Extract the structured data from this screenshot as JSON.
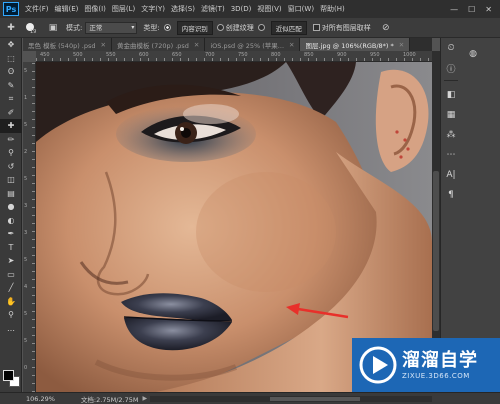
{
  "app": {
    "logo": "Ps"
  },
  "menubar": {
    "items": [
      "文件(F)",
      "编辑(E)",
      "图像(I)",
      "图层(L)",
      "文字(Y)",
      "选择(S)",
      "滤镜(T)",
      "3D(D)",
      "视图(V)",
      "窗口(W)",
      "帮助(H)"
    ],
    "window_controls": [
      "—",
      "☐",
      "✕"
    ]
  },
  "options": {
    "brush_size": "19",
    "mode_label": "模式:",
    "mode_value": "正常",
    "type_label": "类型:",
    "type_options": [
      {
        "label": "内容识别",
        "selected": true
      },
      {
        "label": "创建纹理",
        "selected": false
      },
      {
        "label": "近似匹配",
        "selected": false
      }
    ],
    "sample_all_label": "对所有图层取样"
  },
  "tabs": [
    {
      "label": "黑色 模板 (540p) .psd",
      "active": false
    },
    {
      "label": "黄金曲模板 (720p) .psd",
      "active": false
    },
    {
      "label": "iOS.psd @ 25% (苹果...",
      "active": false
    },
    {
      "label": "图层.jpg @ 106%(RGB/8*) *",
      "active": true
    }
  ],
  "rulers": {
    "top_ticks": [
      "450",
      "500",
      "550",
      "600",
      "650",
      "700",
      "750",
      "800",
      "850",
      "900",
      "950",
      "1000"
    ],
    "left_ticks": [
      "5",
      "1",
      "5",
      "2",
      "5",
      "3",
      "3",
      "5",
      "4",
      "5",
      "5",
      "0"
    ]
  },
  "tools": [
    {
      "name": "move-tool",
      "glyph": "✥"
    },
    {
      "name": "marquee-tool",
      "glyph": "⬚"
    },
    {
      "name": "lasso-tool",
      "glyph": "ʘ"
    },
    {
      "name": "quick-select-tool",
      "glyph": "✎"
    },
    {
      "name": "crop-tool",
      "glyph": "⌗"
    },
    {
      "name": "eyedropper-tool",
      "glyph": "✐"
    },
    {
      "name": "healing-brush-tool",
      "glyph": "✚"
    },
    {
      "name": "brush-tool",
      "glyph": "✏"
    },
    {
      "name": "clone-stamp-tool",
      "glyph": "⚲"
    },
    {
      "name": "history-brush-tool",
      "glyph": "↺"
    },
    {
      "name": "eraser-tool",
      "glyph": "◫"
    },
    {
      "name": "gradient-tool",
      "glyph": "▤"
    },
    {
      "name": "blur-tool",
      "glyph": "●"
    },
    {
      "name": "dodge-tool",
      "glyph": "◐"
    },
    {
      "name": "pen-tool",
      "glyph": "✒"
    },
    {
      "name": "type-tool",
      "glyph": "T"
    },
    {
      "name": "path-select-tool",
      "glyph": "➤"
    },
    {
      "name": "shape-tool",
      "glyph": "▭"
    },
    {
      "name": "line-tool",
      "glyph": "╱"
    },
    {
      "name": "hand-tool",
      "glyph": "✋"
    },
    {
      "name": "zoom-tool",
      "glyph": "⚲"
    },
    {
      "name": "more-tools",
      "glyph": "…"
    }
  ],
  "dock": {
    "icons": [
      {
        "name": "history-panel-icon",
        "glyph": "⏲"
      },
      {
        "name": "info-panel-icon",
        "glyph": "ⓘ"
      },
      {
        "name": "layers-panel-icon",
        "glyph": "◧"
      },
      {
        "name": "channels-panel-icon",
        "glyph": "▦"
      },
      {
        "name": "brush-presets-icon",
        "glyph": "⁂"
      },
      {
        "name": "paths-panel-icon",
        "glyph": "⋯"
      },
      {
        "name": "character-panel-icon",
        "glyph": "A|"
      },
      {
        "name": "paragraph-panel-icon",
        "glyph": "¶"
      }
    ],
    "swatch_icon_glyph": "◍"
  },
  "status": {
    "zoom": "106.29%",
    "doc": "文档:2.75M/2.75M",
    "arrow": "▶"
  },
  "watermark": {
    "name": "溜溜自学",
    "url": "ZIXUE.3D66.COM"
  },
  "colors": {
    "accent": "#31a8ff",
    "annotation_arrow": "#e8302a",
    "watermark_bg": "#1d67b5"
  }
}
